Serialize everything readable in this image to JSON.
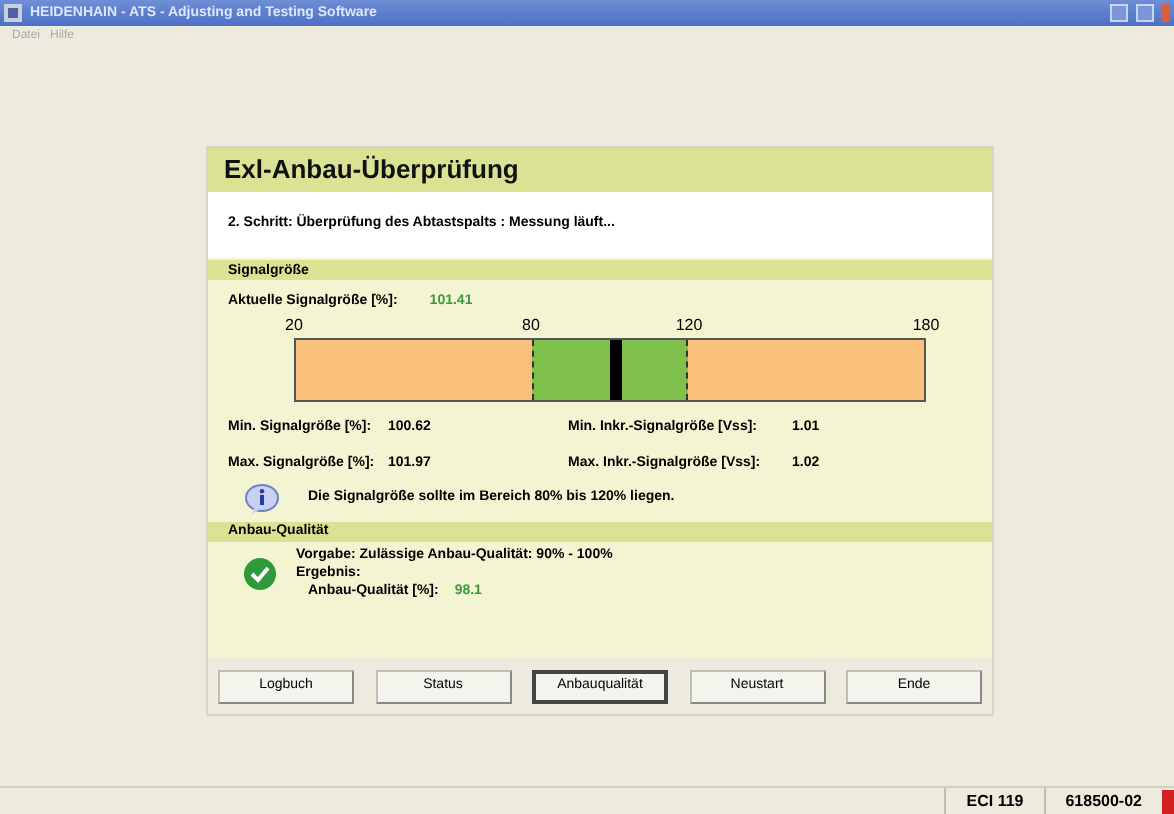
{
  "window": {
    "title": "HEIDENHAIN - ATS - Adjusting and Testing Software"
  },
  "menu": [
    "Datei",
    "Hilfe"
  ],
  "dialog": {
    "title": "Exl-Anbau-Überprüfung",
    "step": "2. Schritt: Überprüfung des Abtastspalts : Messung läuft...",
    "signal": {
      "heading": "Signalgröße",
      "current_label": "Aktuelle Signalgröße [%]:",
      "current_value": "101.41",
      "scale": {
        "ticks": [
          "20",
          "80",
          "120",
          "180"
        ],
        "level": 0.509
      },
      "stats": [
        {
          "label": "Min. Signalgröße [%]:",
          "value": "100.62"
        },
        {
          "label": "Min. Inkr.-Signalgröße [Vss]:",
          "value": "1.01"
        },
        {
          "label": "Max. Signalgröße [%]:",
          "value": "101.97"
        },
        {
          "label": "Max. Inkr.-Signalgröße [Vss]:",
          "value": "1.02"
        }
      ],
      "hint": "Die Signalgröße sollte im Bereich 80% bis 120% liegen."
    },
    "quality": {
      "heading": "Anbau-Qualität",
      "requirement": "Vorgabe: Zulässige Anbau-Qualität: 90% - 100%",
      "result_label": "Ergebnis:",
      "value_label": "Anbau-Qualität [%]:",
      "value": "98.1",
      "passed": true
    },
    "buttons": [
      {
        "label": "Logbuch",
        "selected": false
      },
      {
        "label": "Status",
        "selected": false
      },
      {
        "label": "Anbauqualität",
        "selected": true
      },
      {
        "label": "Neustart",
        "selected": false
      },
      {
        "label": "Ende",
        "selected": false
      }
    ]
  },
  "status_bar": [
    "ECI 119",
    "618500-02"
  ]
}
